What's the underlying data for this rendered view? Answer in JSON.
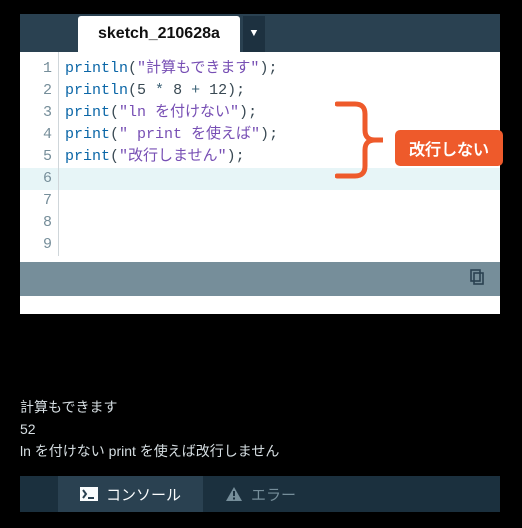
{
  "tab": {
    "title": "sketch_210628a"
  },
  "code": {
    "lines": [
      {
        "n": 1,
        "tokens": [
          [
            "fn",
            "println"
          ],
          [
            "pn",
            "("
          ],
          [
            "str",
            "\"計算もできます\""
          ],
          [
            "pn",
            ")"
          ],
          [
            "pn",
            ";"
          ]
        ]
      },
      {
        "n": 2,
        "tokens": [
          [
            "fn",
            "println"
          ],
          [
            "pn",
            "("
          ],
          [
            "num",
            "5"
          ],
          [
            "op",
            " * "
          ],
          [
            "num",
            "8"
          ],
          [
            "op",
            " + "
          ],
          [
            "num",
            "12"
          ],
          [
            "pn",
            ")"
          ],
          [
            "pn",
            ";"
          ]
        ]
      },
      {
        "n": 3,
        "tokens": [
          [
            "fn",
            "print"
          ],
          [
            "pn",
            "("
          ],
          [
            "str",
            "\"ln を付けない\""
          ],
          [
            "pn",
            ")"
          ],
          [
            "pn",
            ";"
          ]
        ]
      },
      {
        "n": 4,
        "tokens": [
          [
            "fn",
            "print"
          ],
          [
            "pn",
            "("
          ],
          [
            "str",
            "\" print を使えば\""
          ],
          [
            "pn",
            ")"
          ],
          [
            "pn",
            ";"
          ]
        ]
      },
      {
        "n": 5,
        "tokens": [
          [
            "fn",
            "print"
          ],
          [
            "pn",
            "("
          ],
          [
            "str",
            "\"改行しません\""
          ],
          [
            "pn",
            ")"
          ],
          [
            "pn",
            ";"
          ]
        ]
      }
    ],
    "current_line": 6,
    "total_lines": 9
  },
  "annotation": {
    "label": "改行しない"
  },
  "console": {
    "output": "計算もできます\n52\nln を付けない print を使えば改行しません"
  },
  "bottom_tabs": {
    "console": "コンソール",
    "errors": "エラー"
  }
}
